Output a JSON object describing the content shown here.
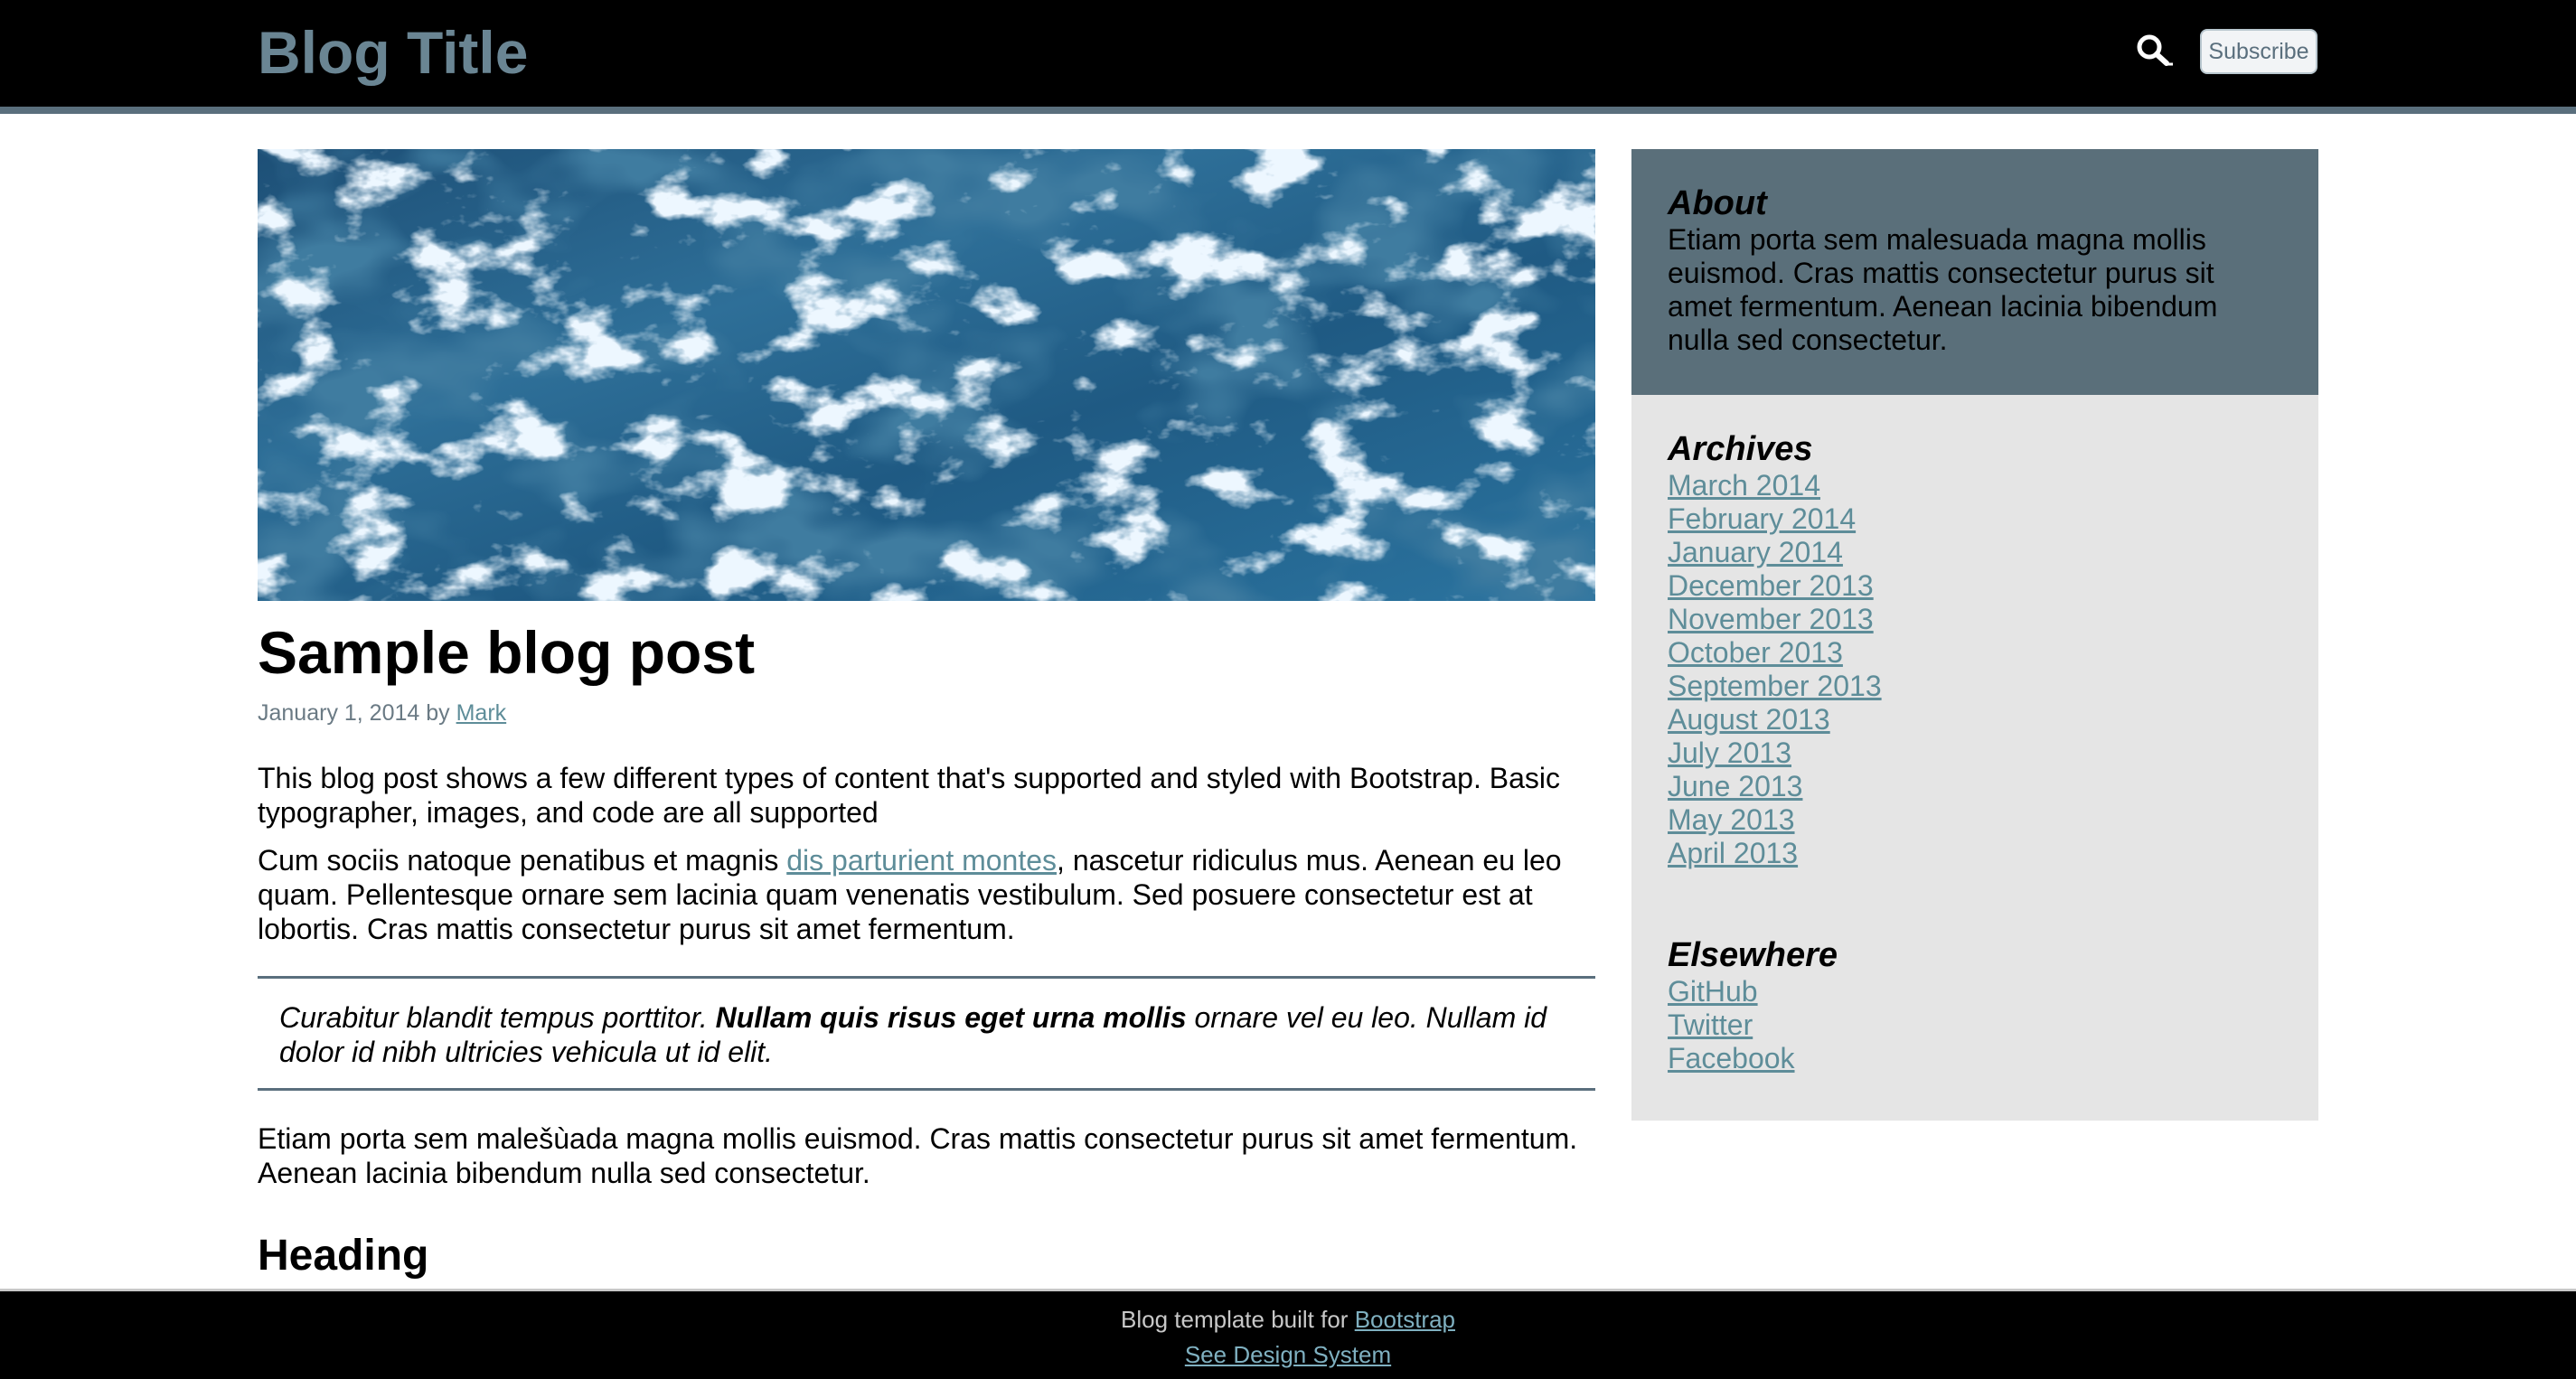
{
  "header": {
    "title": "Blog Title",
    "subscribe_label": "Subscribe",
    "search_icon": "search-icon"
  },
  "post": {
    "title": "Sample blog post",
    "date": "January 1, 2014",
    "by": "by",
    "author": "Mark",
    "p1": "This blog post shows a few different types of content that's supported and styled with Bootstrap. Basic typographer, images, and code are all supported",
    "p2_before": "Cum sociis natoque penatibus et magnis ",
    "p2_link": "dis parturient montes",
    "p2_after": ", nascetur ridiculus mus. Aenean eu leo quam. Pellentesque ornare sem lacinia quam venenatis vestibulum. Sed posuere consectetur est at lobortis. Cras mattis consectetur purus sit amet fermentum.",
    "quote_before": "Curabitur blandit tempus porttitor. ",
    "quote_bold": "Nullam quis risus eget urna mollis",
    "quote_after": " ornare vel eu leo. Nullam id dolor id nibh ultricies vehicula ut id elit.",
    "p3": "Etiam porta sem malešùada magna mollis euismod. Cras mattis consectetur purus sit amet fermentum. Aenean lacinia bibendum nulla sed consectetur.",
    "heading": "Heading"
  },
  "sidebar": {
    "about_title": "About",
    "about_text": "Etiam porta sem malesuada magna mollis euismod. Cras mattis consectetur purus sit amet fermentum. Aenean lacinia bibendum nulla sed consectetur.",
    "archives_title": "Archives",
    "archives": [
      "March 2014",
      "February 2014",
      "January 2014",
      "December 2013",
      "November 2013",
      "October 2013",
      "September 2013",
      "August 2013",
      "July 2013",
      "June 2013",
      "May 2013",
      "April 2013"
    ],
    "elsewhere_title": "Elsewhere",
    "elsewhere": [
      "GitHub",
      "Twitter",
      "Facebook"
    ]
  },
  "footer": {
    "line1_text": "Blog template built for ",
    "line1_link": "Bootstrap",
    "line2_link": "See Design System"
  },
  "colors": {
    "header_bg": "#000000",
    "title_color": "#6a8593",
    "link": "#5e8d99",
    "about_bg": "#5a6f7a",
    "sidebar_bg": "#e5e5e5"
  }
}
